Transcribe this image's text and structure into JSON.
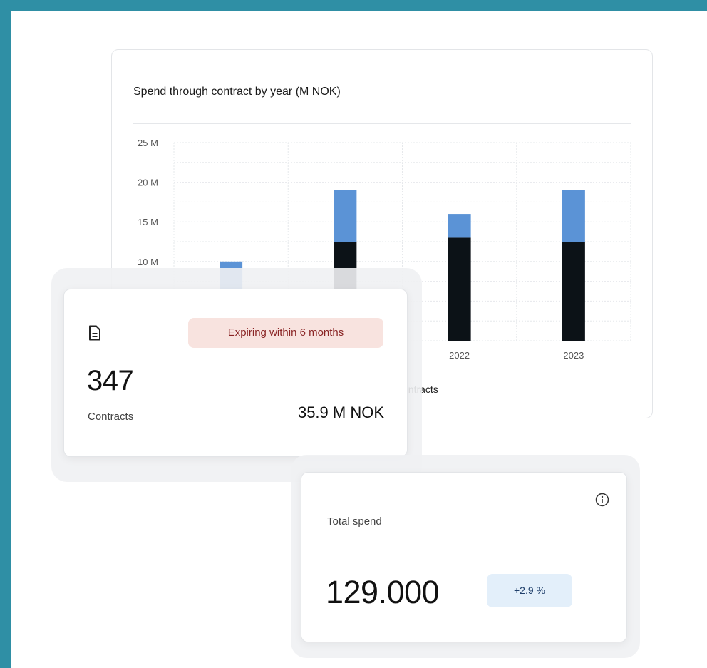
{
  "chart_data": {
    "type": "bar",
    "stacked": true,
    "title": "Spend through contract by year (M NOK)",
    "categories": [
      "",
      "",
      "2022",
      "2023"
    ],
    "series": [
      {
        "values": [
          0,
          12.5,
          13,
          12.5
        ],
        "color": "#0c1217"
      },
      {
        "values": [
          10,
          6.5,
          3,
          6.5
        ],
        "color": "#5b93d6"
      }
    ],
    "yticks": [
      "25 M",
      "20 M",
      "15 M",
      "10 M"
    ],
    "ylim": [
      0,
      25
    ],
    "grid": true,
    "legend_partial": "ontracts"
  },
  "contracts_card": {
    "badge": "Expiring within 6 months",
    "count": "347",
    "count_label": "Contracts",
    "amount": "35.9 M NOK",
    "icon": "document-icon",
    "badge_bg": "#f8e3df",
    "badge_color": "#8a2525"
  },
  "spend_card": {
    "label": "Total spend",
    "value": "129.000",
    "change": "+2.9 %",
    "icon": "info-icon",
    "change_bg": "#e3effa"
  }
}
